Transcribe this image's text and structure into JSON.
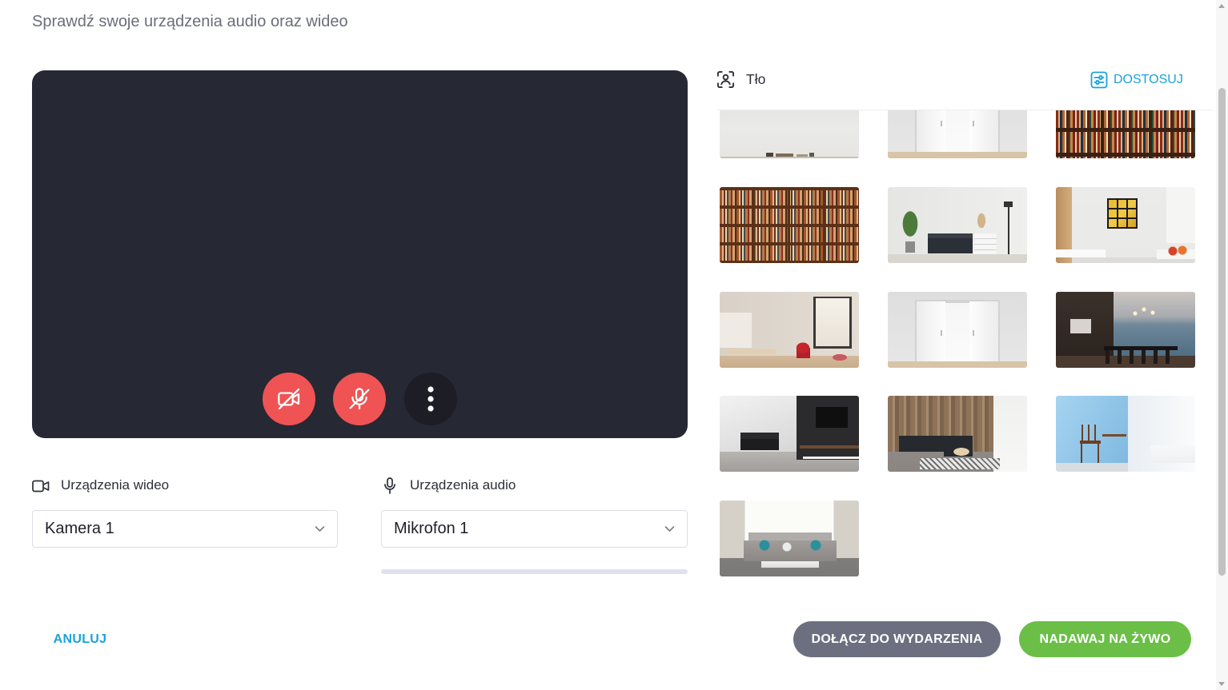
{
  "header": {
    "title": "Sprawdź swoje urządzenia audio oraz wideo"
  },
  "preview": {
    "camera_toggle": {
      "icon": "video-off-icon",
      "enabled": false
    },
    "microphone_toggle": {
      "icon": "microphone-off-icon",
      "enabled": false
    },
    "more_options": {
      "icon": "more-vertical-icon"
    }
  },
  "video_devices": {
    "label": "Urządzenia wideo",
    "icon": "video-camera-icon",
    "selected": "Kamera 1"
  },
  "audio_devices": {
    "label": "Urządzenia audio",
    "icon": "microphone-icon",
    "selected": "Mikrofon 1",
    "input_level": 0
  },
  "background": {
    "label": "Tło",
    "icon": "person-frame-icon",
    "customize": {
      "label": "DOSTOSUJ",
      "icon": "sliders-icon"
    }
  },
  "footer": {
    "cancel_label": "ANULUJ",
    "join_label": "DOŁĄCZ DO WYDARZENIA",
    "live_label": "NADAWAJ NA ŻYWO"
  },
  "colors": {
    "accent": "#1ba2d8",
    "danger": "#ef5353",
    "join_button": "#6b6f80",
    "live_button": "#6bbf47",
    "preview_background": "#262833"
  }
}
